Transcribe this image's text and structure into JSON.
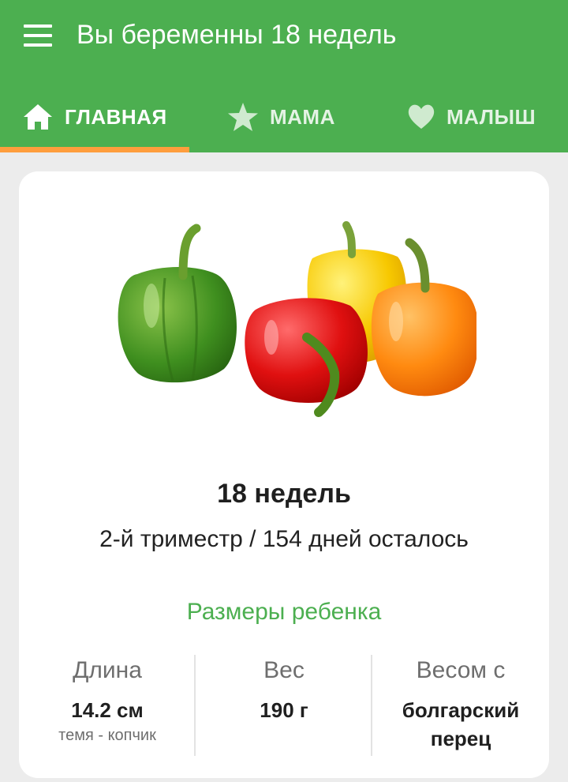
{
  "header": {
    "title": "Вы беременны 18 недель"
  },
  "tabs": [
    {
      "label": "ГЛАВНАЯ",
      "icon": "home-icon",
      "active": true
    },
    {
      "label": "МАМА",
      "icon": "star-icon",
      "active": false
    },
    {
      "label": "МАЛЫШ",
      "icon": "heart-icon",
      "active": false
    }
  ],
  "colors": {
    "primary": "#4caf50",
    "tab_indicator": "#ff9e3d",
    "accent_text": "#4caf50"
  },
  "week_card": {
    "week_title": "18 недель",
    "subtitle": "2-й триместр / 154 дней осталось",
    "sizes_title": "Размеры ребенка",
    "stats": [
      {
        "label": "Длина",
        "value": "14.2 см",
        "note": "темя - копчик"
      },
      {
        "label": "Вес",
        "value": "190 г",
        "note": ""
      },
      {
        "label": "Весом с",
        "value_line1": "болгарский",
        "value_line2": "перец"
      }
    ]
  }
}
